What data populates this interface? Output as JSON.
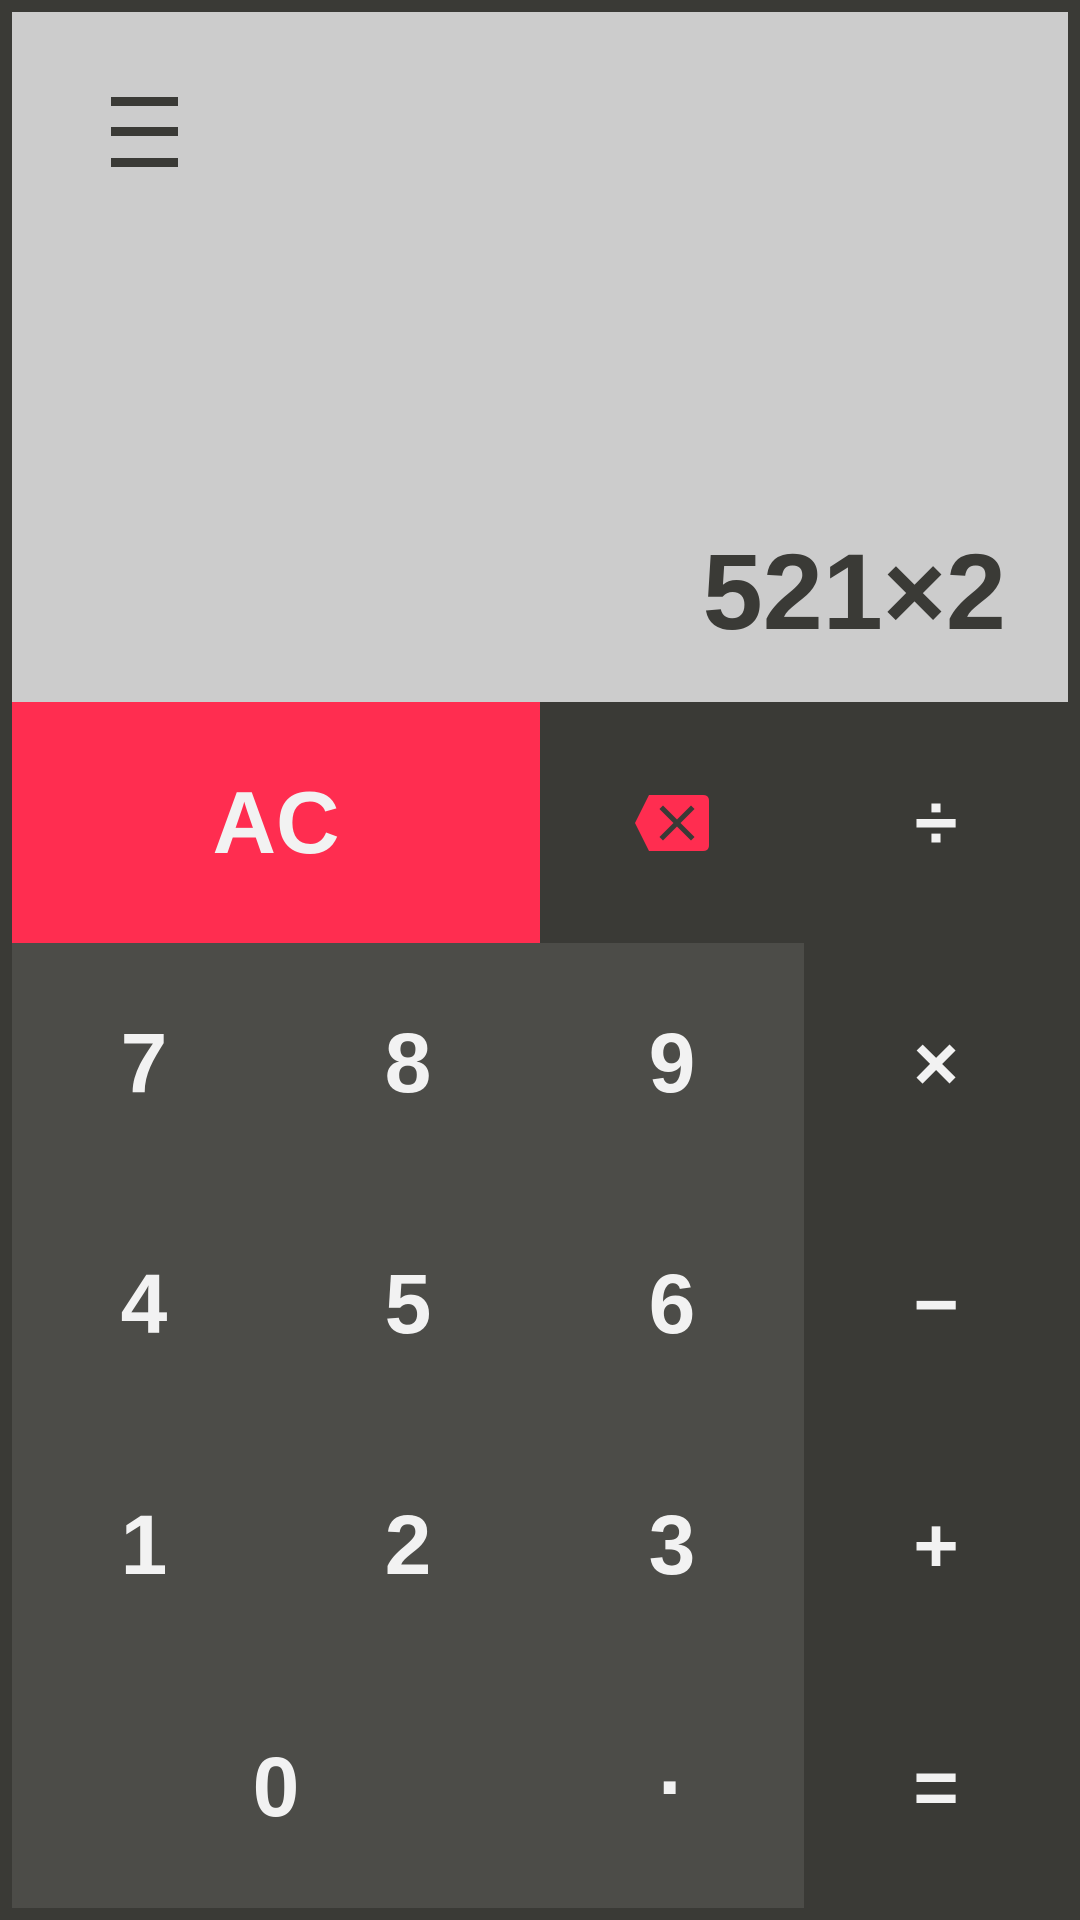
{
  "display": {
    "expression": "521×2"
  },
  "icons": {
    "menu": "menu-icon",
    "backspace": "backspace-icon"
  },
  "colors": {
    "background": "#3a3a36",
    "display_background": "#cccccc",
    "numpad_background": "#4c4c48",
    "accent": "#ff2d50",
    "key_text": "#f2f2f2"
  },
  "keys": {
    "clear": "AC",
    "digits": {
      "d0": "0",
      "d1": "1",
      "d2": "2",
      "d3": "3",
      "d4": "4",
      "d5": "5",
      "d6": "6",
      "d7": "7",
      "d8": "8",
      "d9": "9"
    },
    "decimal": "·",
    "operators": {
      "divide": "÷",
      "multiply": "×",
      "subtract": "−",
      "add": "+",
      "equals": "="
    }
  }
}
